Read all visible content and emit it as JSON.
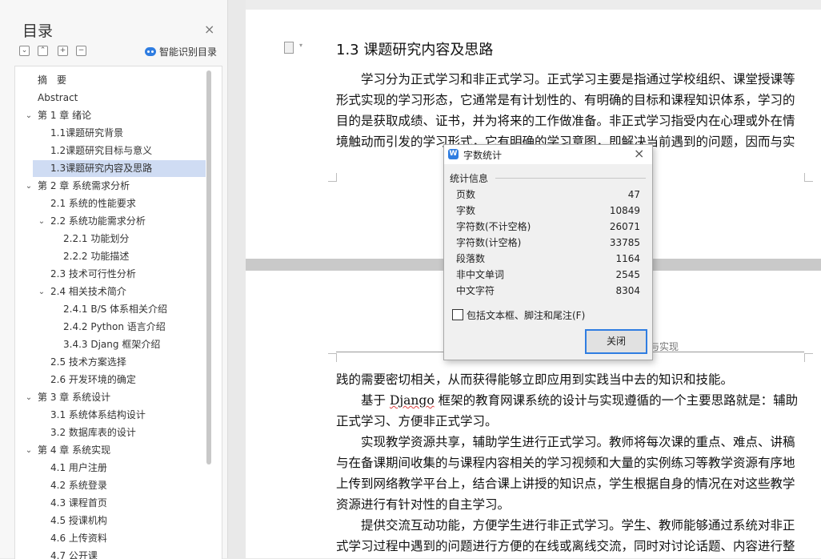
{
  "toc": {
    "title": "目录",
    "close": "×",
    "expand_all": "⌄",
    "collapse_all": "⌃",
    "add_level": "+",
    "remove_level": "−",
    "smart_label": "智能识别目录",
    "items": [
      {
        "label": "摘　要",
        "level": 0,
        "expander": ""
      },
      {
        "label": "Abstract",
        "level": 0,
        "expander": ""
      },
      {
        "label": "第 1 章  绪论",
        "level": 0,
        "expander": "⌄"
      },
      {
        "label": "1.1课题研究背景",
        "level": 1,
        "expander": ""
      },
      {
        "label": "1.2课题研究目标与意义",
        "level": 1,
        "expander": ""
      },
      {
        "label": "1.3课题研究内容及思路",
        "level": 1,
        "expander": "",
        "selected": true
      },
      {
        "label": "第 2 章  系统需求分析",
        "level": 0,
        "expander": "⌄"
      },
      {
        "label": "2.1 系统的性能要求",
        "level": 1,
        "expander": ""
      },
      {
        "label": "2.2 系统功能需求分析",
        "level": 1,
        "expander": "⌄"
      },
      {
        "label": "2.2.1 功能划分",
        "level": 2,
        "expander": ""
      },
      {
        "label": "2.2.2 功能描述",
        "level": 2,
        "expander": ""
      },
      {
        "label": "2.3 技术可行性分析",
        "level": 1,
        "expander": ""
      },
      {
        "label": "2.4 相关技术简介",
        "level": 1,
        "expander": "⌄"
      },
      {
        "label": "2.4.1 B/S 体系相关介绍",
        "level": 2,
        "expander": ""
      },
      {
        "label": "2.4.2 Python 语言介绍",
        "level": 2,
        "expander": ""
      },
      {
        "label": "3.4.3 Djang 框架介绍",
        "level": 2,
        "expander": ""
      },
      {
        "label": "2.5 技术方案选择",
        "level": 1,
        "expander": ""
      },
      {
        "label": "2.6 开发环境的确定",
        "level": 1,
        "expander": ""
      },
      {
        "label": "第 3 章  系统设计",
        "level": 0,
        "expander": "⌄"
      },
      {
        "label": "3.1 系统体系结构设计",
        "level": 1,
        "expander": ""
      },
      {
        "label": "3.2 数据库表的设计",
        "level": 1,
        "expander": ""
      },
      {
        "label": "第 4 章  系统实现",
        "level": 0,
        "expander": "⌄"
      },
      {
        "label": "4.1 用户注册",
        "level": 1,
        "expander": ""
      },
      {
        "label": "4.2 系统登录",
        "level": 1,
        "expander": ""
      },
      {
        "label": "4.3 课程首页",
        "level": 1,
        "expander": ""
      },
      {
        "label": "4.5 授课机构",
        "level": 1,
        "expander": ""
      },
      {
        "label": "4.6 上传资料",
        "level": 1,
        "expander": ""
      },
      {
        "label": "4.7 公开课",
        "level": 1,
        "expander": ""
      }
    ]
  },
  "document": {
    "page_menu_arrow": "▾",
    "heading": "1.3  课题研究内容及思路",
    "para1": "学习分为正式学习和非正式学习。正式学习主要是指通过学校组织、课堂授课等形式实现的学习形态，它通常是有计划性的、有明确的目标和课程知识体系，学习的目的是获取成绩、证书，并为将来的工作做准备。非正式学习指受内在心理或外在情境触动而引发的学习形式，它有明确的学习意图，即解决当前遇到的问题，因而与实",
    "header_text": "与实现",
    "para2": "践的需要密切相关，从而获得能够立即应用到实践当中去的知识和技能。",
    "para3_pre": "　　基于 ",
    "para3_word": "Django",
    "para3_post": " 框架的教育网课系统的设计与实现遵循的一个主要思路就是：辅助正式学习、方便非正式学习。",
    "para4": "　　实现教学资源共享，辅助学生进行正式学习。教师将每次课的重点、难点、讲稿与在备课期间收集的与课程内容相关的学习视频和大量的实例练习等教学资源有序地上传到网络教学平台上，结合课上讲授的知识点，学生根据自身的情况在对这些教学资源进行有针对性的自主学习。",
    "para5": "　　提供交流互动功能，方便学生进行非正式学习。学生、教师能够通过系统对非正式学习过程中遇到的问题进行方便的在线或离线交流，同时对讨论话题、内容进行整"
  },
  "dialog": {
    "icon_letter": "W",
    "title": "字数统计",
    "close": "×",
    "section": "统计信息",
    "stats": [
      {
        "label": "页数",
        "value": "47"
      },
      {
        "label": "字数",
        "value": "10849"
      },
      {
        "label": "字符数(不计空格)",
        "value": "26071"
      },
      {
        "label": "字符数(计空格)",
        "value": "33785"
      },
      {
        "label": "段落数",
        "value": "1164"
      },
      {
        "label": "非中文单词",
        "value": "2545"
      },
      {
        "label": "中文字符",
        "value": "8304"
      }
    ],
    "checkbox_label": "包括文本框、脚注和尾注(F)",
    "checkbox_checked": false,
    "button": "关闭"
  }
}
